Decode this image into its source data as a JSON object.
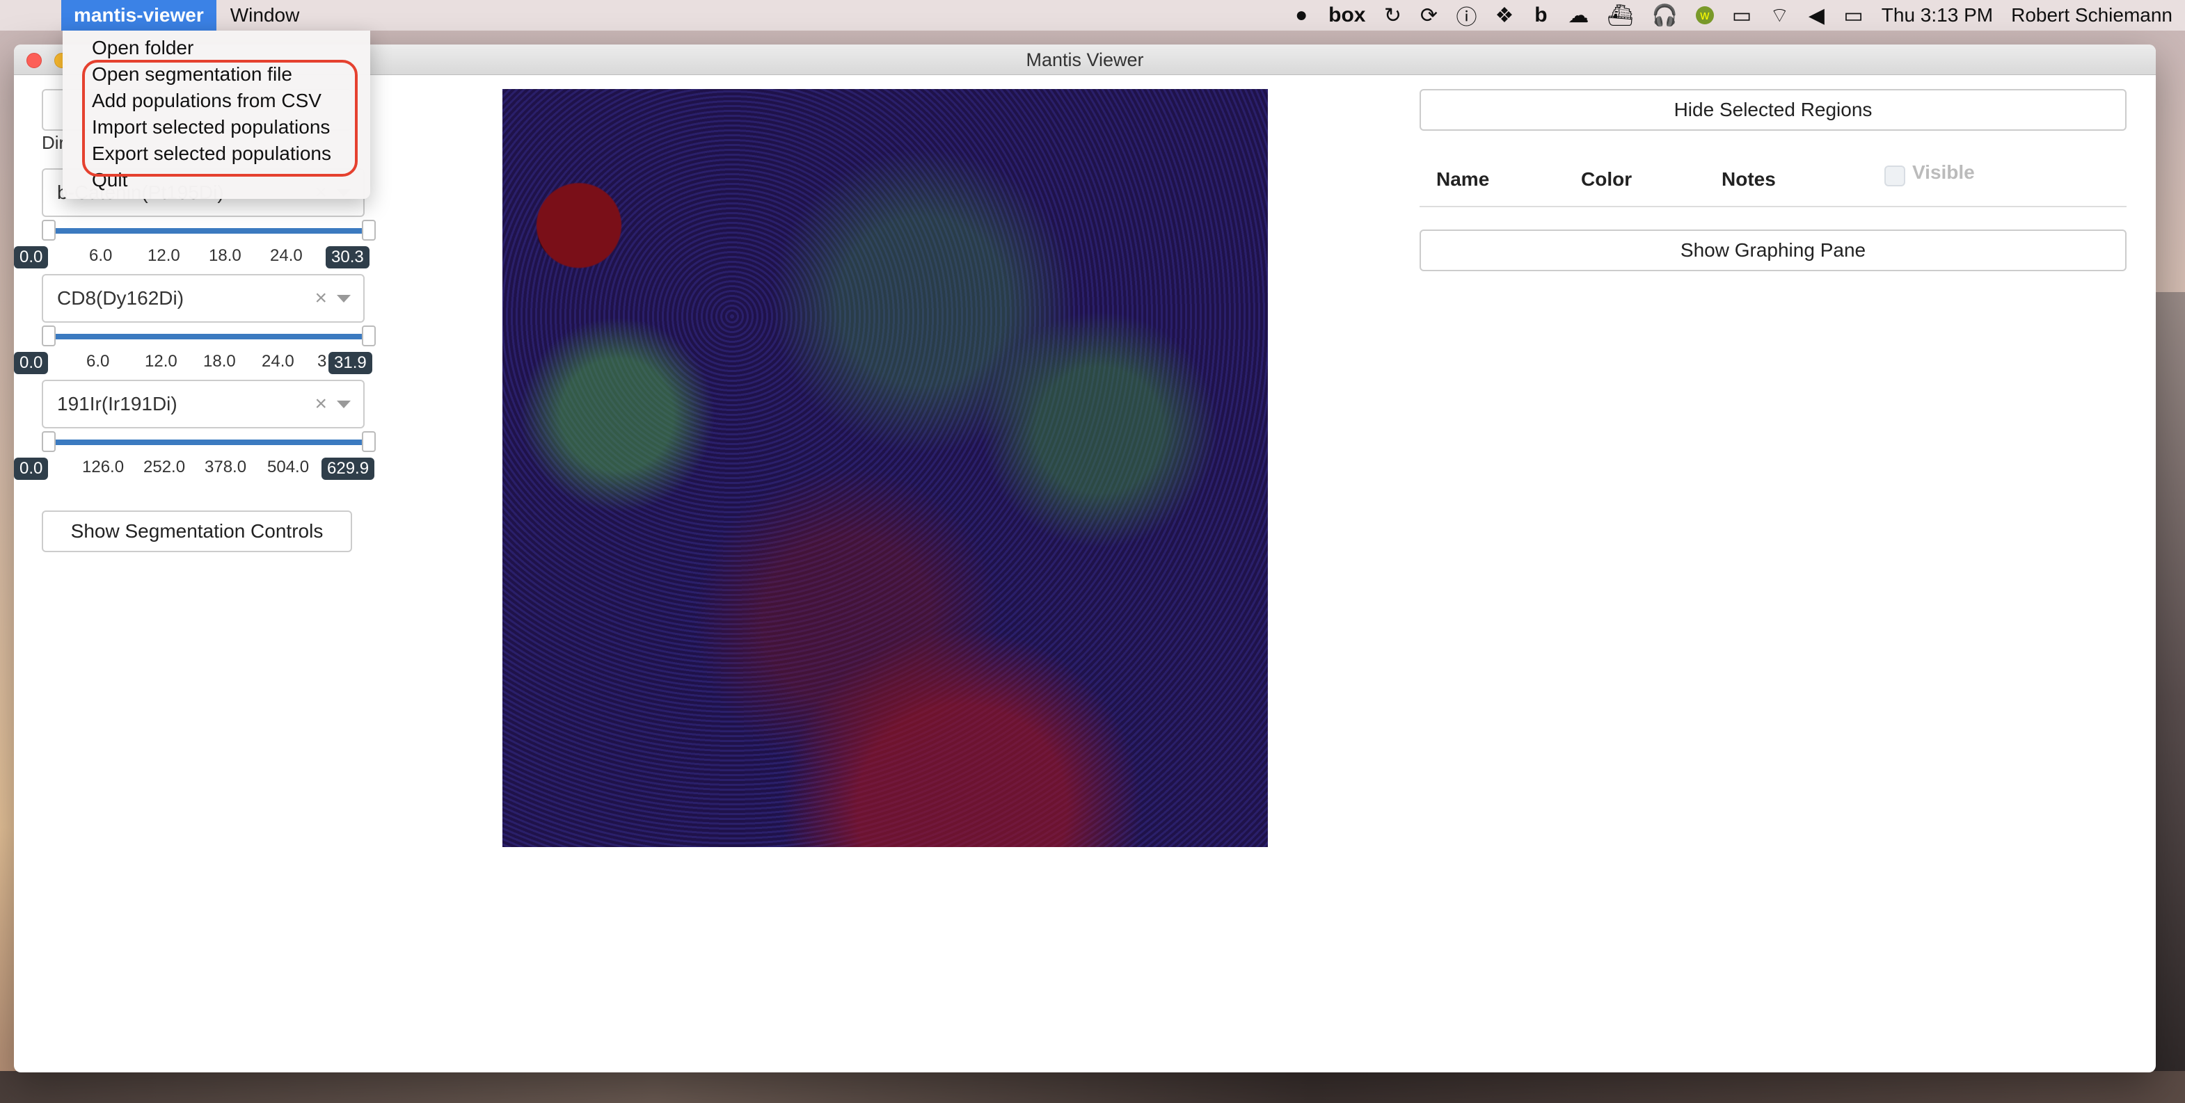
{
  "menubar": {
    "app_name": "mantis-viewer",
    "menus": [
      "Window"
    ],
    "status_icons": [
      "message-icon",
      "box-icon",
      "sync-icon",
      "refresh-icon",
      "info-icon",
      "dropbox-icon",
      "b-icon",
      "cloud-upload-icon",
      "docker-icon",
      "headphones-icon",
      "w-icon",
      "airplay-icon",
      "wifi-icon",
      "volume-icon",
      "battery-icon"
    ],
    "clock": "Thu 3:13 PM",
    "user": "Robert Schiemann"
  },
  "window": {
    "title": "Mantis Viewer"
  },
  "left_panel": {
    "dim_label": "Dir",
    "channels": [
      {
        "value": "b-Catenin(Pt195Di)",
        "ticks": [
          "0.0",
          "6.0",
          "12.0",
          "18.0",
          "24.0",
          "30.3"
        ]
      },
      {
        "value": "CD8(Dy162Di)",
        "ticks": [
          "0.0",
          "6.0",
          "12.0",
          "18.0",
          "24.0",
          "3",
          "31.9"
        ]
      },
      {
        "value": "191Ir(Ir191Di)",
        "ticks": [
          "0.0",
          "126.0",
          "252.0",
          "378.0",
          "504.0",
          "629.9"
        ]
      }
    ],
    "segmentation_button": "Show Segmentation Controls"
  },
  "right_panel": {
    "hide_button": "Hide Selected Regions",
    "columns": {
      "name": "Name",
      "color": "Color",
      "notes": "Notes",
      "visible": "Visible"
    },
    "graph_button": "Show Graphing Pane"
  },
  "dropdown": {
    "items": [
      "Open folder",
      "Open segmentation file",
      "Add populations from CSV",
      "Import selected populations",
      "Export selected populations",
      "Quit"
    ],
    "highlight_color": "#e5412f"
  }
}
